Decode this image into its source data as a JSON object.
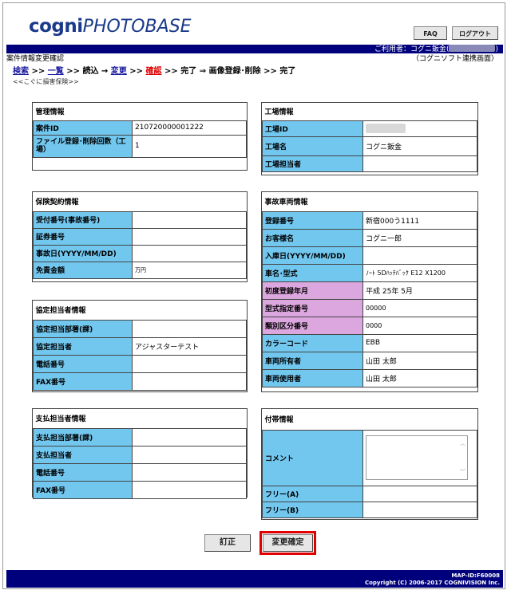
{
  "header": {
    "logo_main": "cogni",
    "logo_sub": "PHOTOBASE",
    "faq_label": "FAQ",
    "logout_label": "ログアウト",
    "user_label": "ご利用者：コグニ鈑金("
  },
  "title": {
    "page_title": "案件情報変更確認",
    "subtitle": "（コグニソフト連携画面）"
  },
  "nav": {
    "search": "検索",
    "sep1": " >> ",
    "list": "一覧",
    "sep2": " >> 読込 → ",
    "change": "変更",
    "sep3": " >> ",
    "confirm": "確認",
    "rest": " >> 完了 ⇒ 画像登録･削除 >> 完了",
    "sub": "<<こぐに損害保険>>"
  },
  "kanri": {
    "title": "管理情報",
    "rows": [
      {
        "label": "案件ID",
        "value": "210720000001222"
      },
      {
        "label": "ファイル登録･削除回数（工場）",
        "value": "1"
      }
    ]
  },
  "kojo": {
    "title": "工場情報",
    "rows": [
      {
        "label": "工場ID",
        "value": ""
      },
      {
        "label": "工場名",
        "value": "コグニ鈑金"
      },
      {
        "label": "工場担当者",
        "value": ""
      }
    ]
  },
  "hoken": {
    "title": "保険契約情報",
    "rows": [
      {
        "label": "受付番号(事故番号)",
        "value": ""
      },
      {
        "label": "証券番号",
        "value": ""
      },
      {
        "label": "事故日(YYYY/MM/DD)",
        "value": ""
      },
      {
        "label": "免責金額",
        "value": "万円"
      }
    ]
  },
  "jiko": {
    "title": "事故車両情報",
    "rows": [
      {
        "label": "登録番号",
        "value": "新宿000う1111"
      },
      {
        "label": "お客様名",
        "value": "コグニ一郎"
      },
      {
        "label": "入庫日(YYYY/MM/DD)",
        "value": ""
      },
      {
        "label": "車名･型式",
        "value": "ﾉｰﾄ 5Dﾊｯﾁﾊﾞｯｸ E12 X1200"
      },
      {
        "label": "初度登録年月",
        "value": "平成 25年 5月"
      },
      {
        "label": "型式指定番号",
        "value": "00000"
      },
      {
        "label": "類別区分番号",
        "value": "0000"
      },
      {
        "label": "カラーコード",
        "value": "EBB"
      },
      {
        "label": "車両所有者",
        "value": "山田 太郎"
      },
      {
        "label": "車両使用者",
        "value": "山田 太郎"
      }
    ]
  },
  "kyotei": {
    "title": "協定担当者情報",
    "rows": [
      {
        "label": "協定担当部署(課)",
        "value": ""
      },
      {
        "label": "協定担当者",
        "value": "アジャスターテスト"
      },
      {
        "label": "電話番号",
        "value": ""
      },
      {
        "label": "FAX番号",
        "value": ""
      }
    ]
  },
  "shiharai": {
    "title": "支払担当者情報",
    "rows": [
      {
        "label": "支払担当部署(課)",
        "value": ""
      },
      {
        "label": "支払担当者",
        "value": ""
      },
      {
        "label": "電話番号",
        "value": ""
      },
      {
        "label": "FAX番号",
        "value": ""
      }
    ]
  },
  "futai": {
    "title": "付帯情報",
    "comment_label": "コメント",
    "free_a": "フリー(A)",
    "free_b": "フリー(B)"
  },
  "buttons": {
    "correct": "訂正",
    "confirm_change": "変更確定"
  },
  "footer": {
    "map_id": "MAP-ID:F60008",
    "copyright": "Copyright (C) 2006-2017 COGNIVISION Inc."
  },
  "colors": {
    "header_bar": "#00007c",
    "label_blue": "#72c7ef",
    "label_pink": "#dca6de",
    "highlight": "#e00000"
  }
}
